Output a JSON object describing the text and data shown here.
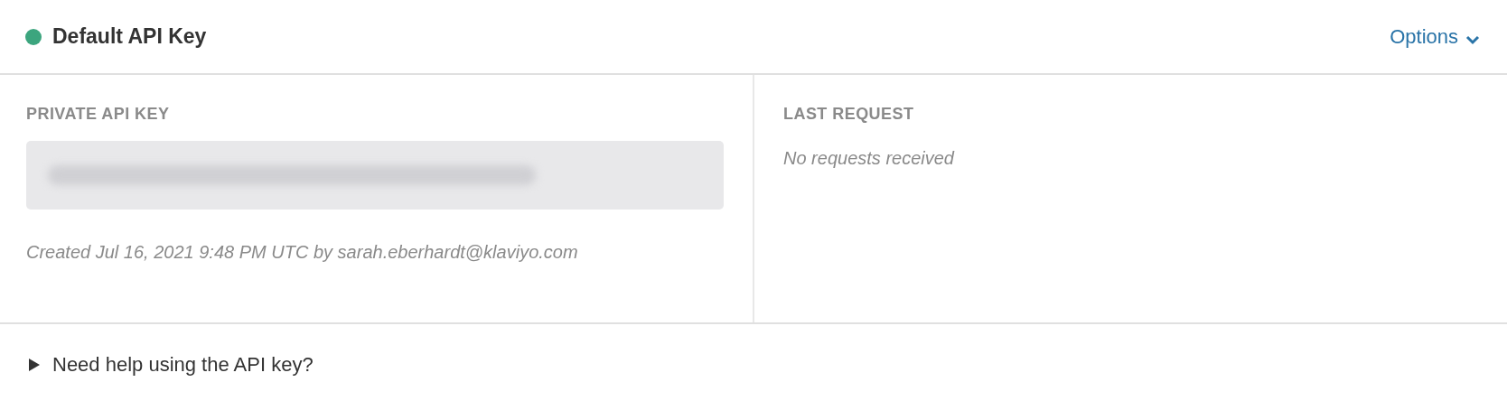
{
  "header": {
    "title": "Default API Key",
    "active": true,
    "options": "Options"
  },
  "private_key": {
    "label": "PRIVATE API KEY",
    "created": "Created Jul 16, 2021 9:48 PM UTC by sarah.eberhardt@klaviyo.com"
  },
  "last_request": {
    "label": "LAST REQUEST",
    "value": "No requests received"
  },
  "help": {
    "label": "Need help using the API key?",
    "expanded": false
  }
}
